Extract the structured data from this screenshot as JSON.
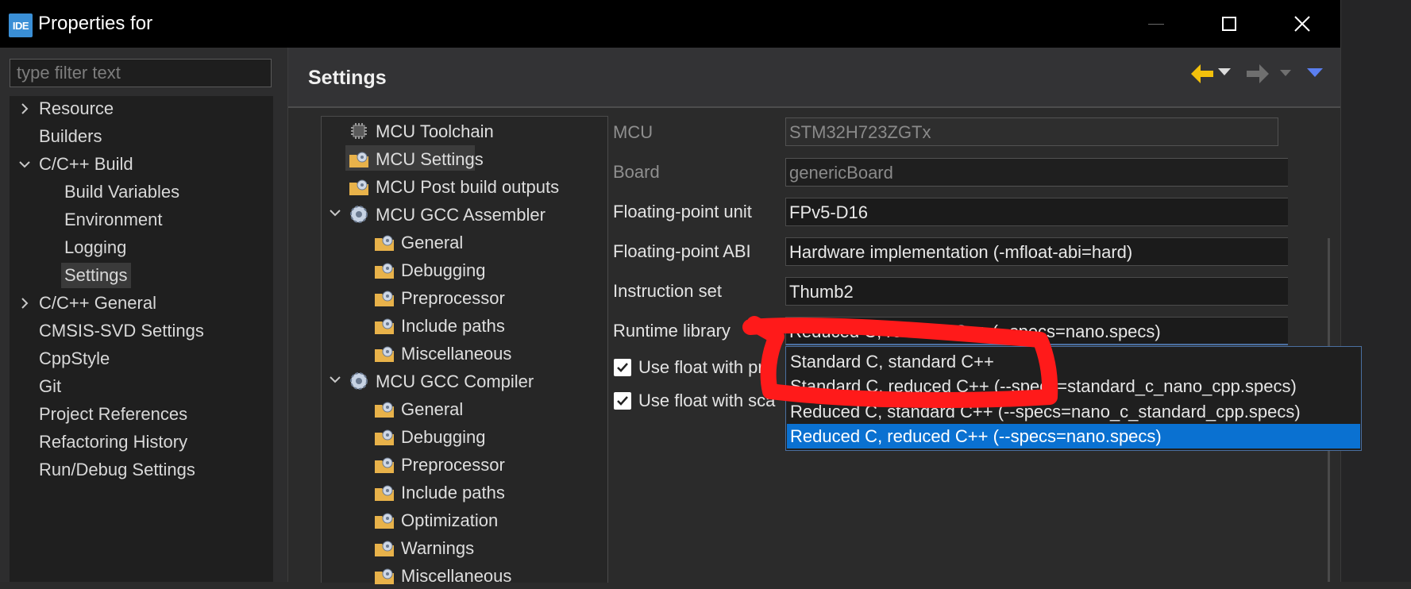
{
  "window": {
    "app_icon_text": "IDE",
    "title": "Properties for",
    "minimize_glyph": "—",
    "maximize_glyph": "☐",
    "close_glyph": "✕"
  },
  "filter": {
    "placeholder": "type filter text",
    "value": ""
  },
  "nav": {
    "items": [
      {
        "label": "Resource",
        "expandable": true,
        "expanded": false
      },
      {
        "label": "Builders"
      },
      {
        "label": "C/C++ Build",
        "expandable": true,
        "expanded": true
      },
      {
        "label": "Build Variables"
      },
      {
        "label": "Environment"
      },
      {
        "label": "Logging"
      },
      {
        "label": "Settings",
        "selected": true
      },
      {
        "label": "C/C++ General",
        "expandable": true,
        "expanded": false
      },
      {
        "label": "CMSIS-SVD Settings"
      },
      {
        "label": "CppStyle"
      },
      {
        "label": "Git"
      },
      {
        "label": "Project References"
      },
      {
        "label": "Refactoring History"
      },
      {
        "label": "Run/Debug Settings"
      }
    ]
  },
  "page": {
    "title": "Settings"
  },
  "colors": {
    "accent_arrow": "#f2c00c",
    "selection": "#0a71d1",
    "annotation": "#ff1a1a"
  },
  "tools": {
    "items": [
      {
        "label": "MCU Toolchain",
        "icon": "chip-icon"
      },
      {
        "label": "MCU Settings",
        "icon": "folder-gear-icon",
        "selected": true
      },
      {
        "label": "MCU Post build outputs",
        "icon": "folder-gear-icon"
      },
      {
        "label": "MCU GCC Assembler",
        "icon": "gear-icon",
        "expanded": true
      },
      {
        "label": "General",
        "icon": "folder-gear-icon"
      },
      {
        "label": "Debugging",
        "icon": "folder-gear-icon"
      },
      {
        "label": "Preprocessor",
        "icon": "folder-gear-icon"
      },
      {
        "label": "Include paths",
        "icon": "folder-gear-icon"
      },
      {
        "label": "Miscellaneous",
        "icon": "folder-gear-icon"
      },
      {
        "label": "MCU GCC Compiler",
        "icon": "gear-icon",
        "expanded": true
      },
      {
        "label": "General",
        "icon": "folder-gear-icon"
      },
      {
        "label": "Debugging",
        "icon": "folder-gear-icon"
      },
      {
        "label": "Preprocessor",
        "icon": "folder-gear-icon"
      },
      {
        "label": "Include paths",
        "icon": "folder-gear-icon"
      },
      {
        "label": "Optimization",
        "icon": "folder-gear-icon"
      },
      {
        "label": "Warnings",
        "icon": "folder-gear-icon"
      },
      {
        "label": "Miscellaneous",
        "icon": "folder-gear-icon"
      }
    ]
  },
  "form": {
    "mcu": {
      "label": "MCU",
      "value": "STM32H723ZGTx"
    },
    "board": {
      "label": "Board",
      "value": "genericBoard"
    },
    "fpu": {
      "label": "Floating-point unit",
      "value": "FPv5-D16"
    },
    "fabi": {
      "label": "Floating-point ABI",
      "value": "Hardware implementation (-mfloat-abi=hard)"
    },
    "iset": {
      "label": "Instruction set",
      "value": "Thumb2"
    },
    "runtime": {
      "label": "Runtime library",
      "value": "Reduced C, reduced C++ (--specs=nano.specs)"
    },
    "chk1": {
      "label": "Use float with pr",
      "checked": true
    },
    "chk2": {
      "label": "Use float with sca",
      "checked": true
    }
  },
  "dropdown": {
    "options": [
      "Standard C, standard C++",
      "Standard C, reduced C++ (--specs=standard_c_nano_cpp.specs)",
      "Reduced C, standard C++ (--specs=nano_c_standard_cpp.specs)",
      "Reduced C, reduced C++ (--specs=nano.specs)"
    ],
    "selected_index": 3
  }
}
